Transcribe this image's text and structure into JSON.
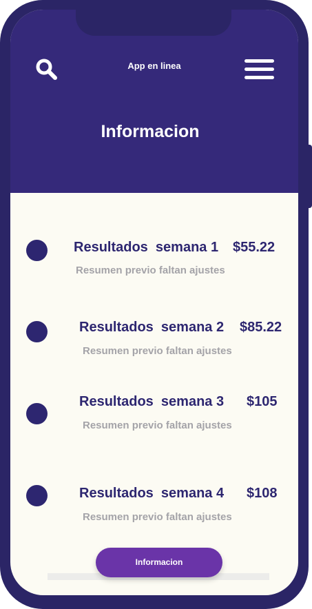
{
  "header": {
    "app_title": "App en linea",
    "page_title": "Informacion"
  },
  "items": [
    {
      "title": "Resultados  semana 1",
      "price": "$55.22",
      "subtitle": "Resumen previo faltan ajustes"
    },
    {
      "title": "Resultados  semana 2",
      "price": "$85.22",
      "subtitle": "Resumen previo faltan ajustes"
    },
    {
      "title": "Resultados  semana 3",
      "price": "$105",
      "subtitle": "Resumen previo faltan ajustes"
    },
    {
      "title": "Resultados  semana 4",
      "price": "$108",
      "subtitle": "Resumen previo faltan ajustes"
    }
  ],
  "footer": {
    "button_label": "Informacion"
  },
  "icons": {
    "search": "search-icon",
    "menu": "hamburger-menu-icon"
  },
  "colors": {
    "header": "#35297a",
    "frame": "#2b2566",
    "accent": "#6a34a8",
    "text_primary": "#2d2670",
    "text_secondary": "#a4a3a8",
    "content_bg": "#fcfbf3"
  }
}
